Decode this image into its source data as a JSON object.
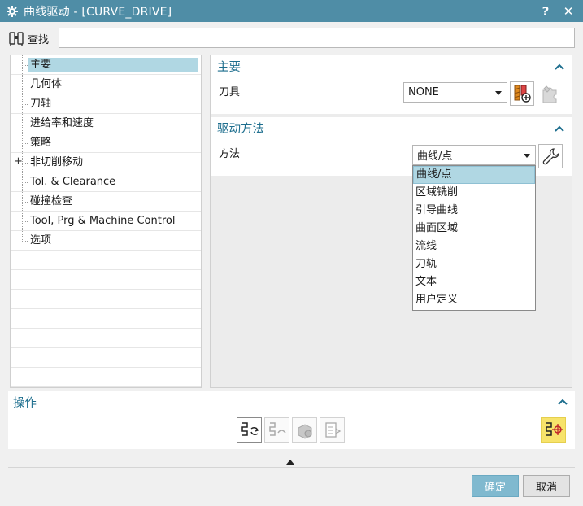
{
  "window": {
    "title": "曲线驱动 - [CURVE_DRIVE]",
    "help_label": "?",
    "close_label": "✕"
  },
  "find": {
    "label": "查找",
    "value": "",
    "placeholder": ""
  },
  "tree": {
    "items": [
      {
        "label": "主要",
        "selected": true,
        "expander": false
      },
      {
        "label": "几何体",
        "selected": false,
        "expander": false
      },
      {
        "label": "刀轴",
        "selected": false,
        "expander": false
      },
      {
        "label": "进给率和速度",
        "selected": false,
        "expander": false
      },
      {
        "label": "策略",
        "selected": false,
        "expander": false
      },
      {
        "label": "非切削移动",
        "selected": false,
        "expander": true
      },
      {
        "label": "Tol. & Clearance",
        "selected": false,
        "expander": false
      },
      {
        "label": "碰撞检查",
        "selected": false,
        "expander": false
      },
      {
        "label": "Tool, Prg & Machine Control",
        "selected": false,
        "expander": false
      },
      {
        "label": "选项",
        "selected": false,
        "expander": false
      }
    ]
  },
  "main_section": {
    "title": "主要",
    "tool_label": "刀具",
    "tool_value": "NONE"
  },
  "drive_section": {
    "title": "驱动方法",
    "method_label": "方法",
    "method_value": "曲线/点",
    "options": [
      "曲线/点",
      "区域铣削",
      "引导曲线",
      "曲面区域",
      "流线",
      "刀轨",
      "文本",
      "用户定义"
    ]
  },
  "operations": {
    "title": "操作"
  },
  "buttons": {
    "ok": "确定",
    "cancel": "取消"
  },
  "colors": {
    "titlebar": "#4f8da6",
    "section_title": "#1d6e8e",
    "selection": "#b0d7e3",
    "ok_button": "#80b9cf"
  }
}
